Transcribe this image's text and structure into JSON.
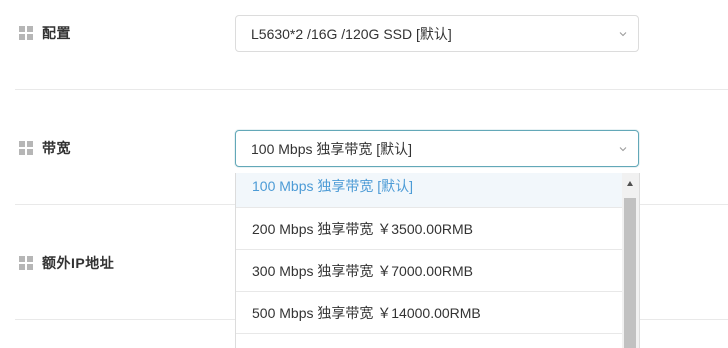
{
  "form": {
    "config": {
      "label": "配置",
      "value": "L5630*2 /16G /120G SSD [默认]"
    },
    "bandwidth": {
      "label": "带宽",
      "value": "100 Mbps 独享带宽 [默认]",
      "options": [
        {
          "label": "100 Mbps 独享带宽 [默认]",
          "selected": true
        },
        {
          "label": "200 Mbps 独享带宽 ￥3500.00RMB",
          "selected": false
        },
        {
          "label": "300 Mbps 独享带宽 ￥7000.00RMB",
          "selected": false
        },
        {
          "label": "500 Mbps 独享带宽 ￥14000.00RMB",
          "selected": false
        }
      ]
    },
    "extra_ip": {
      "label": "额外IP地址"
    }
  },
  "icons": {
    "label_icon": "grid-icon",
    "select_arrow": "chevron-down-icon",
    "scroll_up": "scroll-up-arrow-icon"
  },
  "colors": {
    "focus_border": "#63a8b8",
    "selected_option_text": "#4c9bd6",
    "selected_option_bg": "#f2f7fb",
    "label_icon": "#b6b6b6"
  }
}
